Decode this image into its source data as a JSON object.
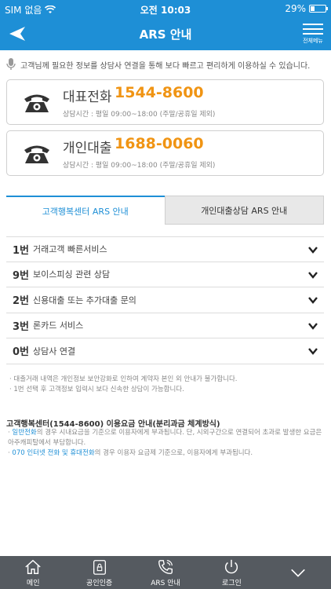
{
  "status_bar": {
    "carrier": "SIM 없음",
    "time": "오전 10:03",
    "battery": "29%"
  },
  "header": {
    "title": "ARS 안내",
    "menu_label": "전체메뉴"
  },
  "notice": "고객님께 필요한 정보를 상담사 연결을 통해 보다 빠르고 편리하게 이용하실 수 있습니다.",
  "cards": [
    {
      "name": "대표전화",
      "number": "1544-8600",
      "hours": "상담시간 : 평일 09:00~18:00 (주말/공휴일 제외)"
    },
    {
      "name": "개인대출",
      "number": "1688-0060",
      "hours": "상담시간 : 평일 09:00~18:00 (주말/공휴일 제외)"
    }
  ],
  "tabs": [
    {
      "label": "고객행복센터 ARS 안내",
      "active": true
    },
    {
      "label": "개인대출상담 ARS 안내",
      "active": false
    }
  ],
  "menu_items": [
    {
      "num": "1번",
      "label": "거래고객 빠른서비스"
    },
    {
      "num": "9번",
      "label": "보이스피싱 관련 상담"
    },
    {
      "num": "2번",
      "label": "신용대출 또는 추가대출 문의"
    },
    {
      "num": "3번",
      "label": "론카드 서비스"
    },
    {
      "num": "0번",
      "label": "상담사 연결"
    }
  ],
  "notes": [
    "· 대출거래 내역은 개인정보 보안강화로 인하여 계약자 본인 외 안내가 불가합니다.",
    "· 1번 선택 후 고객정보 입력시 보다 신속한 상담이 가능합니다."
  ],
  "fee": {
    "title": "고객행복센터(1544-8600) 이용요금 안내(분리과금 체계방식)",
    "line1_hl": "일반전화",
    "line1_rest": "의 경우 시내요금을 기준으로 이용자에게 부과됩니다. 단, 시외구간으로 연결되어 초과로 발생한 요금은 아주캐피탈에서 부담합니다.",
    "line2_hl": "070 인터넷 전화 및 휴대전화",
    "line2_rest": "의 경우 이용자 요금제 기준으로, 이용자에게 부과됩니다."
  },
  "bottom_nav": [
    {
      "label": "메인",
      "icon": "home-icon"
    },
    {
      "label": "공인인증",
      "icon": "lock-icon"
    },
    {
      "label": "ARS 안내",
      "icon": "phone-icon"
    },
    {
      "label": "로그인",
      "icon": "power-icon"
    },
    {
      "label": "",
      "icon": "chevron-down-icon"
    }
  ],
  "colors": {
    "brand": "#1e8fd6",
    "number": "#f09413",
    "nav_bg": "#555a60"
  }
}
